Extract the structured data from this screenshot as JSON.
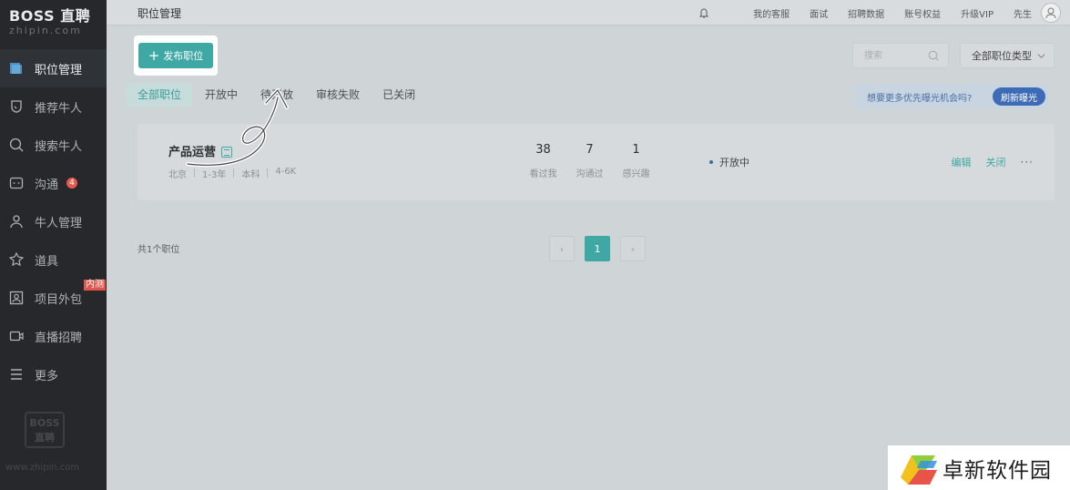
{
  "brand": {
    "name": "BOSS 直聘",
    "domain": "zhipin.com",
    "footer_url": "www.zhipin.com",
    "footer_logo": "BOSS\n直聘"
  },
  "sidebar": {
    "items": [
      {
        "label": "职位管理",
        "icon": "briefcase-icon",
        "active": true
      },
      {
        "label": "推荐牛人",
        "icon": "shield-icon"
      },
      {
        "label": "搜索牛人",
        "icon": "search-icon"
      },
      {
        "label": "沟通",
        "icon": "chat-icon",
        "badge": "4"
      },
      {
        "label": "牛人管理",
        "icon": "person-icon"
      },
      {
        "label": "道具",
        "icon": "tools-icon"
      },
      {
        "label": "项目外包",
        "icon": "portrait-icon",
        "tag": "内测"
      },
      {
        "label": "直播招聘",
        "icon": "video-icon"
      },
      {
        "label": "更多",
        "icon": "menu-icon"
      }
    ]
  },
  "topbar": {
    "title": "职位管理",
    "links": [
      "我的客服",
      "面试",
      "招聘数据",
      "账号权益",
      "升级VIP"
    ],
    "user": "先生"
  },
  "toolbar": {
    "publish_label": "发布职位",
    "search_placeholder": "搜索",
    "type_select": "全部职位类型"
  },
  "tabs": [
    "全部职位",
    "开放中",
    "待开放",
    "审核失败",
    "已关闭"
  ],
  "promo": {
    "text": "想要更多优先曝光机会吗?",
    "button": "刷新曝光"
  },
  "job": {
    "title": "产品运营",
    "city": "北京",
    "experience": "1-3年",
    "education": "本科",
    "salary": "4-6K",
    "stats": [
      {
        "num": "38",
        "label": "看过我"
      },
      {
        "num": "7",
        "label": "沟通过"
      },
      {
        "num": "1",
        "label": "感兴趣"
      }
    ],
    "status": "开放中",
    "actions": {
      "edit": "编辑",
      "close": "关闭",
      "more": "···"
    }
  },
  "pagination": {
    "total": "共1个职位",
    "current": "1",
    "prev": "‹",
    "next": "›"
  },
  "watermark": "卓新软件园",
  "colors": {
    "accent": "#3fa8a5",
    "sidebar": "#26282b",
    "badge": "#e45a4f",
    "promo_btn": "#3e6bb5"
  }
}
